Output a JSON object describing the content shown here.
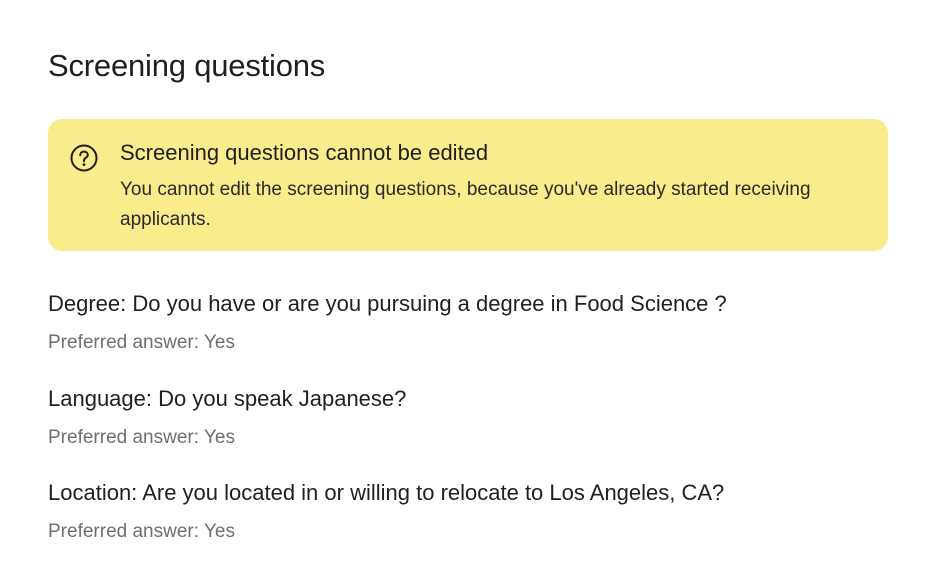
{
  "section": {
    "title": "Screening questions"
  },
  "notice": {
    "icon": "question-circle-icon",
    "title": "Screening questions cannot be edited",
    "body": "You cannot edit the screening questions, because you've already started receiving applicants.",
    "background_color": "#f9ec8c"
  },
  "questions": [
    {
      "text": "Degree: Do you have or are you pursuing a degree in Food Science ?",
      "preferred_answer": "Preferred answer: Yes"
    },
    {
      "text": "Language: Do you speak Japanese?",
      "preferred_answer": "Preferred answer: Yes"
    },
    {
      "text": "Location: Are you located in or willing to relocate to Los Angeles, CA?",
      "preferred_answer": "Preferred answer: Yes"
    }
  ]
}
